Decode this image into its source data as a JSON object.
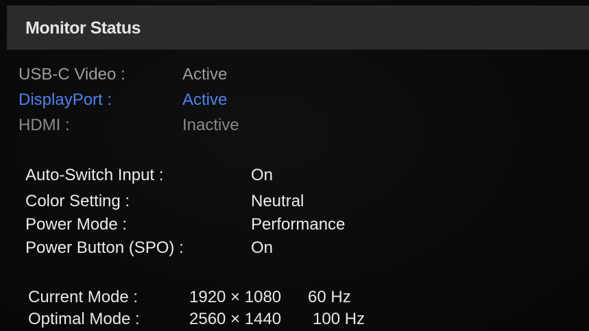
{
  "title": "Monitor Status",
  "ports": [
    {
      "label": "USB-C Video :",
      "value": "Active"
    },
    {
      "label": "DisplayPort :",
      "value": "Active"
    },
    {
      "label": "HDMI :",
      "value": "Inactive"
    }
  ],
  "settings": [
    {
      "label": "Auto-Switch Input :",
      "value": "On"
    },
    {
      "label": "Color Setting :",
      "value": "Neutral"
    },
    {
      "label": "Power Mode :",
      "value": "Performance"
    },
    {
      "label": "Power Button (SPO) :",
      "value": "On"
    }
  ],
  "modes": [
    {
      "label": "Current Mode :",
      "resolution": "1920 × 1080",
      "refresh": "60 Hz"
    },
    {
      "label": "Optimal Mode :",
      "resolution": "2560 × 1440",
      "refresh": "100 Hz"
    }
  ],
  "colors": {
    "selected": "#4f82ea",
    "title_bar": "#2b2b2d",
    "background": "#0b0b0c"
  }
}
